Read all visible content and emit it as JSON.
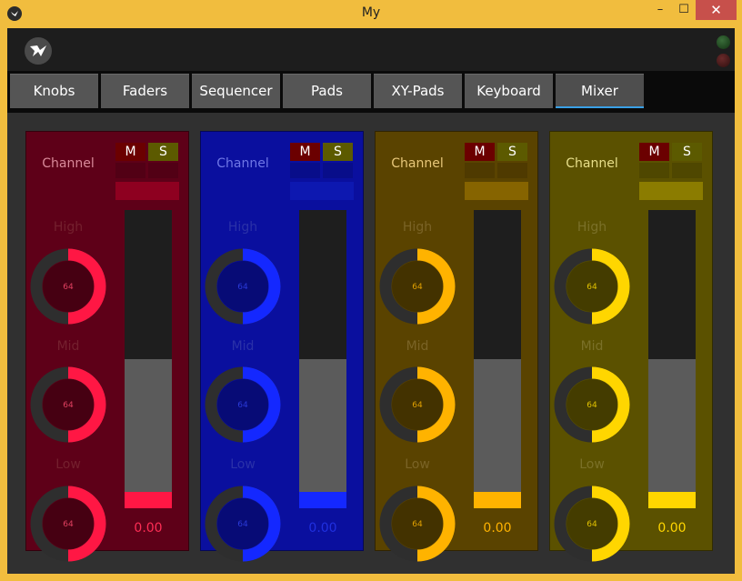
{
  "window": {
    "title": "My",
    "min": "–",
    "max": "☐",
    "close": "✕"
  },
  "tabs": [
    "Knobs",
    "Faders",
    "Sequencer",
    "Pads",
    "XY-Pads",
    "Keyboard",
    "Mixer"
  ],
  "active_tab": 6,
  "eq_bands": [
    "High",
    "Mid",
    "Low"
  ],
  "mute_label": "M",
  "solo_label": "S",
  "channels": [
    {
      "label": "Channel",
      "bg": "#5e0018",
      "accent": "#ff1744",
      "bar": "#8e0020",
      "label_color": "#d98a9a",
      "eq_color": "#74202e",
      "val_color": "#ff2d55",
      "knob_text": "#e04060",
      "knobs": [
        "64",
        "64",
        "64"
      ],
      "knob_values": [
        0.5,
        0.5,
        0.5
      ],
      "fader_value": "0.00",
      "fader_level": 0.5
    },
    {
      "label": "Channel",
      "bg": "#0a0f9e",
      "accent": "#1428ff",
      "bar": "#0d18b0",
      "label_color": "#6f77e6",
      "eq_color": "#2a31a8",
      "val_color": "#2030e0",
      "knob_text": "#2a3ad8",
      "knobs": [
        "64",
        "64",
        "64"
      ],
      "knob_values": [
        0.5,
        0.5,
        0.5
      ],
      "fader_value": "0.00",
      "fader_level": 0.5
    },
    {
      "label": "Channel",
      "bg": "#5a4300",
      "accent": "#ffb300",
      "bar": "#866400",
      "label_color": "#e8c77a",
      "eq_color": "#7a6326",
      "val_color": "#ffb300",
      "knob_text": "#e0a000",
      "knobs": [
        "64",
        "64",
        "64"
      ],
      "knob_values": [
        0.5,
        0.5,
        0.5
      ],
      "fader_value": "0.00",
      "fader_level": 0.5
    },
    {
      "label": "Channel",
      "bg": "#5b5100",
      "accent": "#ffd600",
      "bar": "#8b7c00",
      "label_color": "#e8df8a",
      "eq_color": "#7a7028",
      "val_color": "#ffd600",
      "knob_text": "#e0c000",
      "knobs": [
        "64",
        "64",
        "64"
      ],
      "knob_values": [
        0.5,
        0.5,
        0.5
      ],
      "fader_value": "0.00",
      "fader_level": 0.5
    }
  ]
}
